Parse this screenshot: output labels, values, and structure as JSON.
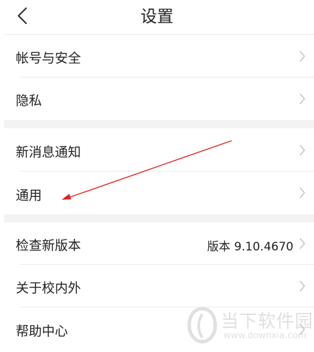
{
  "header": {
    "title": "设置",
    "back_icon": "chevron-left-icon"
  },
  "groups": [
    {
      "items": [
        {
          "label": "帐号与安全",
          "value": ""
        },
        {
          "label": "隐私",
          "value": ""
        }
      ]
    },
    {
      "items": [
        {
          "label": "新消息通知",
          "value": ""
        },
        {
          "label": "通用",
          "value": ""
        }
      ]
    },
    {
      "items": [
        {
          "label": "检查新版本",
          "value": "版本 9.10.4670"
        },
        {
          "label": "关于校内外",
          "value": ""
        },
        {
          "label": "帮助中心",
          "value": ""
        }
      ]
    }
  ],
  "annotation": {
    "arrow_color": "#e02020"
  },
  "watermark": {
    "name": "当下软件园",
    "url": "www.downxia.com"
  },
  "colors": {
    "background": "#ffffff",
    "group_gap": "#f3f3f3",
    "divider": "#ececec",
    "text": "#222222",
    "chevron": "#c4c4c4"
  }
}
